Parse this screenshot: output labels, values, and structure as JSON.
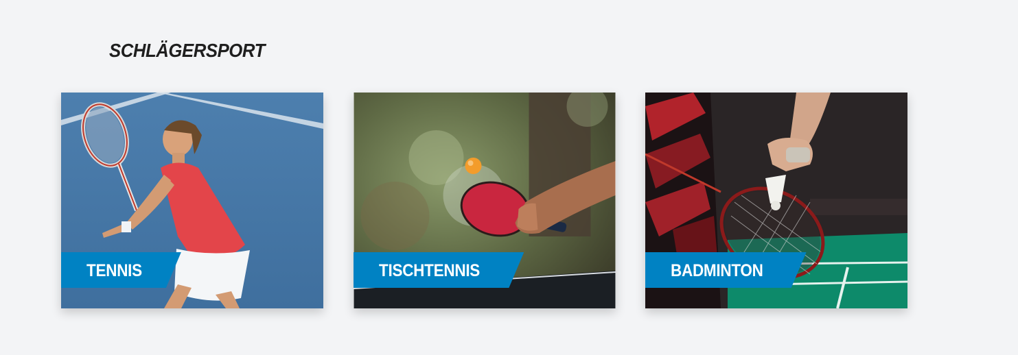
{
  "section": {
    "title": "SCHLÄGERSPORT"
  },
  "cards": [
    {
      "label": "TENNIS",
      "image": "tennis-player-photo"
    },
    {
      "label": "TISCHTENNIS",
      "image": "table-tennis-paddle-photo"
    },
    {
      "label": "BADMINTON",
      "image": "badminton-racket-photo"
    }
  ],
  "colors": {
    "background": "#f3f4f6",
    "label_bg": "#0082c3",
    "label_text": "#ffffff",
    "title_text": "#1f1f1f"
  }
}
